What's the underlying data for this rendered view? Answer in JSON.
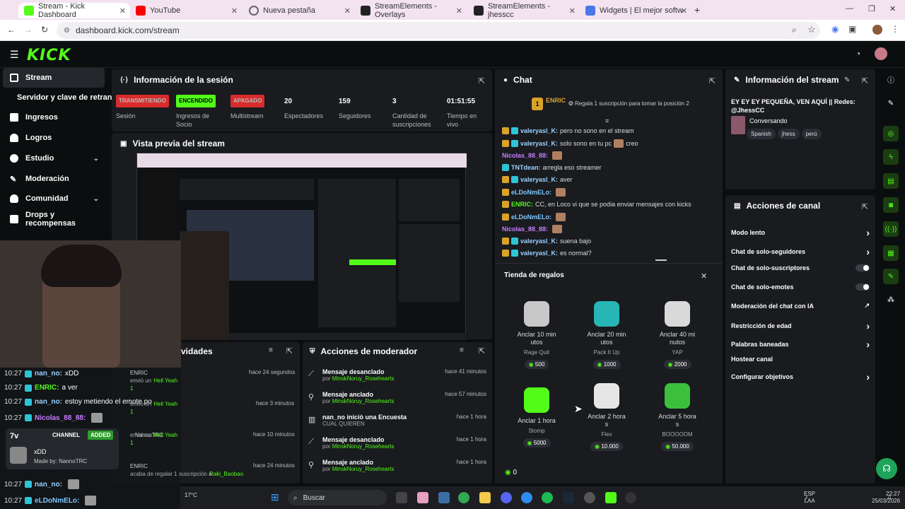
{
  "browser": {
    "tabs": [
      {
        "label": "Stream - Kick Dashboard",
        "active": true
      },
      {
        "label": "YouTube"
      },
      {
        "label": "Nueva pestaña"
      },
      {
        "label": "StreamElements - Overlays"
      },
      {
        "label": "StreamElements - jhesscc"
      },
      {
        "label": "Widgets | El mejor software pa"
      }
    ],
    "url": "dashboard.kick.com/stream"
  },
  "kick": {
    "logo": "KICK",
    "sidebar": [
      {
        "label": "Stream",
        "active": true
      },
      {
        "label": "Servidor y clave de retransm"
      },
      {
        "label": "Ingresos"
      },
      {
        "label": "Logros"
      },
      {
        "label": "Estudio"
      },
      {
        "label": "Moderación"
      },
      {
        "label": "Comunidad"
      },
      {
        "label": "Drops y recompensas"
      }
    ],
    "session": {
      "title": "Información de la sesión",
      "stats": [
        {
          "badge": "TRANSMITIENDO",
          "label": "Sesión"
        },
        {
          "badge": "ENCENDIDO",
          "label": "Ingresos de Socio"
        },
        {
          "badge": "APAGADO",
          "label": "Multistream"
        },
        {
          "value": "20",
          "label": "Espectadores"
        },
        {
          "value": "159",
          "label": "Seguidores"
        },
        {
          "value": "3",
          "label": "Cantidad de suscripciones"
        },
        {
          "value": "01:51:55",
          "label": "Tiempo en vivo"
        }
      ]
    },
    "preview": {
      "title": "Vista previa del stream"
    },
    "activity": {
      "title": "vidades",
      "times": [
        "hace 24 segundos",
        "hace 3 minutos",
        "hace 10 minutos",
        "hace 24 minutos"
      ],
      "footer_user": "Raki_Baobao"
    },
    "modactions": {
      "title": "Acciones de moderador",
      "rows": [
        {
          "title": "Mensaje desanclado",
          "by": "por",
          "user": "MinskNoruy_Rosehearts",
          "time": "hace 41 minutos"
        },
        {
          "title": "Mensaje anclado",
          "by": "por",
          "user": "MinskNoruy_Rosehearts",
          "time": "hace 57 minutos"
        },
        {
          "title": "nan_no iniciò una Encuesta",
          "by": "CUAL QUIEREN",
          "user": "",
          "time": "hace 1 hora"
        },
        {
          "title": "Mensaje desanclado",
          "by": "por",
          "user": "MinskNoruy_Rosehearts",
          "time": "hace 1 hora"
        },
        {
          "title": "Mensaje anclado",
          "by": "por",
          "user": "MinskNoruy_Rosehearts",
          "time": "hace 1 hora"
        }
      ]
    },
    "chat": {
      "title": "Chat",
      "pinned_user": "ENRIC",
      "pinned_rank": "1",
      "pinned_text": "Regala 1 suscripción para tomar la posición 2",
      "messages": [
        {
          "user": "valeryasl_K:",
          "text": "pero no sono en el stream",
          "color": "#9ad0ff"
        },
        {
          "user": "valeryasl_K:",
          "text": "solo sono en tu pc",
          "extra": "creo",
          "color": "#9ad0ff"
        },
        {
          "user": "Nicolas_88_88:",
          "text": "",
          "color": "#c77dff"
        },
        {
          "user": "TNTdean:",
          "text": "arregla eso streamer",
          "color": "#9ad0ff"
        },
        {
          "user": "valeryasl_K:",
          "text": "aver",
          "color": "#9ad0ff"
        },
        {
          "user": "eLDoNmELo:",
          "text": "",
          "color": "#7ec8ff"
        },
        {
          "user": "ENRIC:",
          "text": "CC, en Loco vi que se podia enviar mensajes con kicks",
          "color": "#53fc18"
        },
        {
          "user": "eLDoNmELo:",
          "text": "",
          "color": "#7ec8ff"
        },
        {
          "user": "Nicolas_88_88:",
          "text": "",
          "color": "#c77dff"
        },
        {
          "user": "valeryasl_K:",
          "text": "suena bajo",
          "color": "#9ad0ff"
        },
        {
          "user": "valeryasl_K:",
          "text": "es normal?",
          "color": "#9ad0ff"
        }
      ],
      "gift_store": {
        "title": "Tienda de regalos",
        "items": [
          {
            "name": "Anclar 10 min utos",
            "sub": "Rage Quit",
            "price": "500",
            "color": "#c8c8c8"
          },
          {
            "name": "Anclar 20 min utos",
            "sub": "Pack It Up",
            "price": "1000",
            "color": "#28b5b5"
          },
          {
            "name": "Anclar 40 mi nutos",
            "sub": "YAP",
            "price": "2000",
            "color": "#d9d9d9"
          },
          {
            "name": "Anclar 1 hora",
            "sub": "Stomp",
            "price": "5000",
            "color": "#53fc18"
          },
          {
            "name": "Anclar 2 hora s",
            "sub": "Flex",
            "price": "10.000",
            "color": "#e6e6e6"
          },
          {
            "name": "Anclar 5 hora s",
            "sub": "BOOOOOM",
            "price": "50.000",
            "color": "#3cbf3c"
          }
        ],
        "balance": "0"
      }
    },
    "streaminfo": {
      "title": "Información del stream",
      "text": "EY EY EY PEQUEÑA, VEN AQUÍ || Redes: @JhessCC",
      "category": "Conversando",
      "tags": [
        "Spanish",
        "jhess",
        "perú"
      ]
    },
    "channel_actions": {
      "title": "Acciones de canal",
      "items": [
        {
          "label": "Modo lento",
          "control": "chevron"
        },
        {
          "label": "Chat de solo-seguidores",
          "control": "chevron"
        },
        {
          "label": "Chat de solo-suscriptores",
          "control": "toggle"
        },
        {
          "label": "Chat de solo-emotes",
          "control": "toggle"
        },
        {
          "label": "Moderación del chat con IA",
          "control": "link"
        },
        {
          "label": "Restricción de edad",
          "control": "chevron"
        },
        {
          "label": "Palabras baneadas",
          "control": "chevron"
        },
        {
          "label": "Hostear canal",
          "control": "none"
        },
        {
          "label": "Configurar objetivos",
          "control": "chevron"
        }
      ]
    }
  },
  "overlay_chat": [
    {
      "time": "10:27",
      "user": "nan_no:",
      "text": "xDD",
      "color": "#9ad0ff"
    },
    {
      "time": "10:27",
      "user": "ENRIC:",
      "text": "a ver",
      "color": "#53fc18"
    },
    {
      "time": "10:27",
      "user": "nan_no:",
      "text": "estoy metiendo el emote po",
      "color": "#9ad0ff"
    },
    {
      "time": "10:27",
      "user": "Nicolas_88_88:",
      "text": "",
      "color": "#c77dff"
    },
    {
      "time": "10:27",
      "user": "nan_no:",
      "text": "",
      "color": "#9ad0ff"
    },
    {
      "time": "10:27",
      "user": "eLDoNmELo:",
      "text": "",
      "color": "#7ec8ff"
    }
  ],
  "overlay_widget": {
    "channel": "CHANNEL",
    "added": "ADDED",
    "author": "NannoTRC",
    "emote": "xDD",
    "made_by": "Made by: NannoTRC"
  },
  "overlay_alerts": [
    {
      "user": "ENRIC",
      "text": "envió un",
      "gift": "Hell Yeah",
      "count": "1"
    },
    {
      "user": "",
      "text": "envió un",
      "gift": "Hell Yeah",
      "count": "1"
    },
    {
      "user": "",
      "text": "envió un",
      "gift": "Hell Yeah",
      "count": "1"
    },
    {
      "user": "ENRIC",
      "text": "acaba de regalar 1 suscripción a:",
      "gift": "",
      "count": ""
    }
  ],
  "taskbar": {
    "search": "Buscar",
    "lang": "ESP",
    "lang2": "LAA",
    "time": "22:27",
    "date": "25/03/2026",
    "weather": "17°C"
  }
}
